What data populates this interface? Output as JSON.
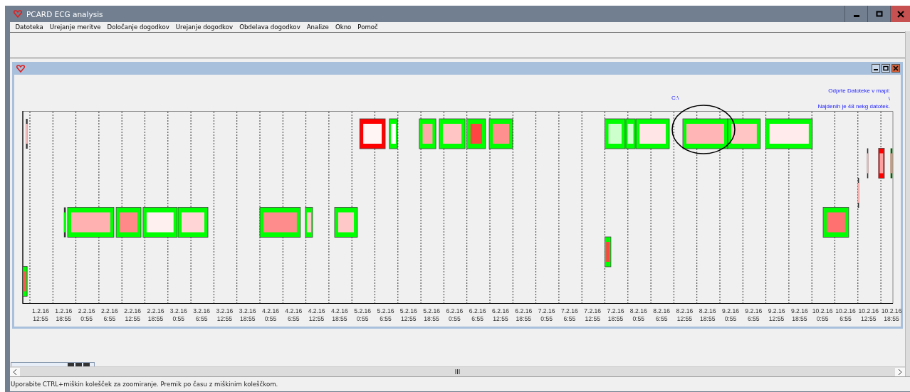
{
  "window": {
    "title": "PCARD ECG analysis"
  },
  "menu": [
    "Datoteka",
    "Urejanje meritve",
    "Določanje dogodkov",
    "Urejanje dogodkov",
    "Obdelava dogodkov",
    "Analize",
    "Okno",
    "Pomoč"
  ],
  "child_window": {
    "folder_path": "C:\\",
    "info_lines": [
      "Odprte Datoteke v mapi:",
      "\\",
      "Najdenih je 48 nekg datotek."
    ],
    "timeline": {
      "ticks": [
        {
          "date": "1.2.16",
          "time": "12:55"
        },
        {
          "date": "1.2.16",
          "time": "18:55"
        },
        {
          "date": "2.2.16",
          "time": "0:55"
        },
        {
          "date": "2.2.16",
          "time": "6:55"
        },
        {
          "date": "2.2.16",
          "time": "12:55"
        },
        {
          "date": "2.2.16",
          "time": "18:55"
        },
        {
          "date": "3.2.16",
          "time": "0:55"
        },
        {
          "date": "3.2.16",
          "time": "6:55"
        },
        {
          "date": "3.2.16",
          "time": "12:55"
        },
        {
          "date": "3.2.16",
          "time": "18:55"
        },
        {
          "date": "4.2.16",
          "time": "0:55"
        },
        {
          "date": "4.2.16",
          "time": "6:55"
        },
        {
          "date": "4.2.16",
          "time": "12:55"
        },
        {
          "date": "4.2.16",
          "time": "18:55"
        },
        {
          "date": "5.2.16",
          "time": "0:55"
        },
        {
          "date": "5.2.16",
          "time": "6:55"
        },
        {
          "date": "5.2.16",
          "time": "12:55"
        },
        {
          "date": "5.2.16",
          "time": "18:55"
        },
        {
          "date": "6.2.16",
          "time": "0:55"
        },
        {
          "date": "6.2.16",
          "time": "6:55"
        },
        {
          "date": "6.2.16",
          "time": "12:55"
        },
        {
          "date": "6.2.16",
          "time": "18:55"
        },
        {
          "date": "7.2.16",
          "time": "0:55"
        },
        {
          "date": "7.2.16",
          "time": "6:55"
        },
        {
          "date": "7.2.16",
          "time": "12:55"
        },
        {
          "date": "7.2.16",
          "time": "18:55"
        },
        {
          "date": "8.2.16",
          "time": "0:55"
        },
        {
          "date": "8.2.16",
          "time": "6:55"
        },
        {
          "date": "8.2.16",
          "time": "12:55"
        },
        {
          "date": "8.2.16",
          "time": "18:55"
        },
        {
          "date": "9.2.16",
          "time": "0:55"
        },
        {
          "date": "9.2.16",
          "time": "6:55"
        },
        {
          "date": "9.2.16",
          "time": "12:55"
        },
        {
          "date": "9.2.16",
          "time": "18:55"
        },
        {
          "date": "10.2.16",
          "time": "0:55"
        },
        {
          "date": "10.2.16",
          "time": "6:55"
        },
        {
          "date": "10.2.16",
          "time": "12:55"
        },
        {
          "date": "10.2.16",
          "time": "18:55"
        }
      ],
      "records": [
        {
          "color": "#ffc0c0"
        },
        {
          "color": "#fff5f5"
        },
        {
          "color": "#ffffff"
        },
        {
          "color": "#ffaaaa"
        },
        {
          "color": "#ffc5c5"
        },
        {
          "color": "#ff4444"
        },
        {
          "color": "#ff9090"
        },
        {
          "color": "#ccffcc"
        },
        {
          "color": "#ccffcc"
        },
        {
          "color": "#ffe5e5"
        },
        {
          "color": "#ffb5b5"
        },
        {
          "color": "#ffc5c5"
        },
        {
          "color": "#ffebeb"
        },
        {
          "color": "#ffb0b0"
        },
        {
          "color": "#ffa0a0"
        },
        {
          "color": "#ff8080"
        },
        {
          "color": "#ffb0b0"
        },
        {
          "color": "#00ff00"
        },
        {
          "color": "#ffb0b0"
        },
        {
          "color": "#ff8888"
        },
        {
          "color": "#fff0f0"
        },
        {
          "color": "#ffd5d5"
        },
        {
          "color": "#ff8c8c"
        },
        {
          "color": "#ffcccc"
        },
        {
          "color": "#ffc8c8"
        },
        {
          "color": "#ff7070"
        },
        {
          "color": "#ff4444"
        },
        {
          "color": "#ff5555"
        }
      ]
    }
  },
  "status_bar": "Uporabite CTRL+miškin kolešček za zoomiranje. Premik po času z miškinim koleščkom."
}
